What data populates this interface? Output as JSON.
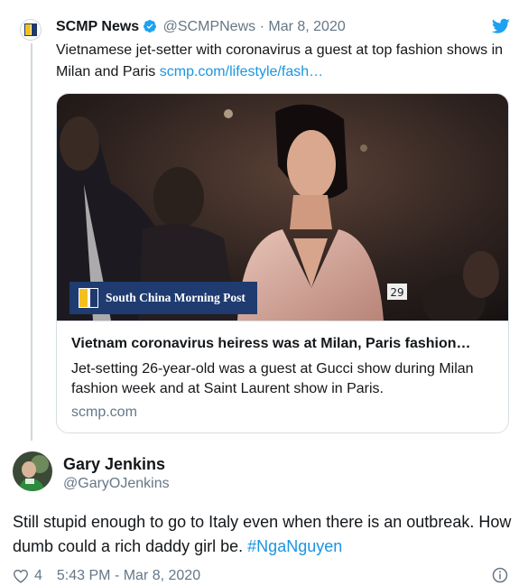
{
  "quoted_tweet": {
    "name": "SCMP News",
    "handle": "@SCMPNews",
    "separator": "·",
    "date": "Mar 8, 2020",
    "text": "Vietnamese jet-setter with coronavirus a guest at top fashion shows in Milan and Paris",
    "link_text": "scmp.com/lifestyle/fash…",
    "card": {
      "badge_text": "South China Morning Post",
      "image_number": "29",
      "title": "Vietnam coronavirus heiress was at Milan, Paris fashion…",
      "description": "Jet-setting 26-year-old was a guest at Gucci show during Milan fashion week and at Saint Laurent show in Paris.",
      "domain": "scmp.com"
    }
  },
  "reply": {
    "name": "Gary Jenkins",
    "handle": "@GaryOJenkins",
    "text": "Still stupid enough to go to Italy even when there is an outbreak. How dumb could a rich daddy girl be.",
    "hashtag": "#NgaNguyen",
    "like_count": "4",
    "timestamp": "5:43 PM - Mar 8, 2020"
  },
  "icons": [
    "verified-icon",
    "twitter-bird-icon",
    "heart-icon",
    "info-icon"
  ],
  "colors": {
    "link": "#1b95e0",
    "muted": "#657786",
    "scmp_navy": "#1f3b70",
    "scmp_yellow": "#f4c11c"
  }
}
